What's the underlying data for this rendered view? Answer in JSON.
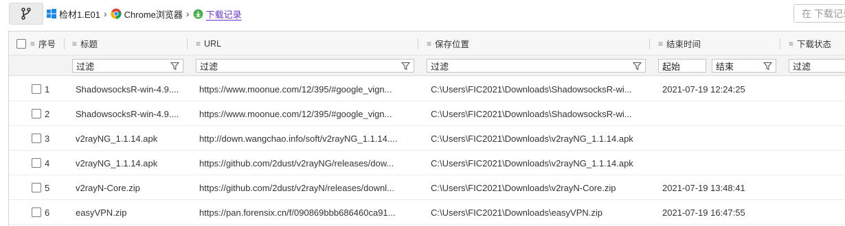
{
  "toolbar": {
    "branch_icon": "git-branch-icon"
  },
  "breadcrumb": [
    {
      "label": "检材1.E01",
      "icon": "windows-icon"
    },
    {
      "label": "Chrome浏览器",
      "icon": "chrome-icon"
    },
    {
      "label": "下载记录",
      "icon": "download-icon"
    }
  ],
  "breadcrumb_separator": "›",
  "search": {
    "placeholder": "在 下载记录中搜索"
  },
  "colors": {
    "breadcrumb_current": "#6a34c9",
    "download_icon": "#4caf50"
  },
  "table": {
    "columns": [
      {
        "key": "index",
        "label": "序号"
      },
      {
        "key": "title",
        "label": "标题"
      },
      {
        "key": "url",
        "label": "URL"
      },
      {
        "key": "save_path",
        "label": "保存位置"
      },
      {
        "key": "end_time",
        "label": "结束时间"
      },
      {
        "key": "status",
        "label": "下载状态"
      }
    ],
    "filters": {
      "title": "过滤",
      "url": "过滤",
      "save_path": "过滤",
      "end_time_start": "起始",
      "end_time_end": "结束",
      "status": "过滤"
    },
    "rows": [
      {
        "index": "1",
        "title": "ShadowsocksR-win-4.9....",
        "url": "https://www.moonue.com/12/395/#google_vign...",
        "save_path": "C:\\Users\\FIC2021\\Downloads\\ShadowsocksR-wi...",
        "end_time": "2021-07-19 12:24:25",
        "status": ""
      },
      {
        "index": "2",
        "title": "ShadowsocksR-win-4.9....",
        "url": "https://www.moonue.com/12/395/#google_vign...",
        "save_path": "C:\\Users\\FIC2021\\Downloads\\ShadowsocksR-wi...",
        "end_time": "",
        "status": ""
      },
      {
        "index": "3",
        "title": "v2rayNG_1.1.14.apk",
        "url": "http://down.wangchao.info/soft/v2rayNG_1.1.14....",
        "save_path": "C:\\Users\\FIC2021\\Downloads\\v2rayNG_1.1.14.apk",
        "end_time": "",
        "status": ""
      },
      {
        "index": "4",
        "title": "v2rayNG_1.1.14.apk",
        "url": "https://github.com/2dust/v2rayNG/releases/dow...",
        "save_path": "C:\\Users\\FIC2021\\Downloads\\v2rayNG_1.1.14.apk",
        "end_time": "",
        "status": ""
      },
      {
        "index": "5",
        "title": "v2rayN-Core.zip",
        "url": "https://github.com/2dust/v2rayN/releases/downl...",
        "save_path": "C:\\Users\\FIC2021\\Downloads\\v2rayN-Core.zip",
        "end_time": "2021-07-19 13:48:41",
        "status": ""
      },
      {
        "index": "6",
        "title": "easyVPN.zip",
        "url": "https://pan.forensix.cn/f/090869bbb686460ca91...",
        "save_path": "C:\\Users\\FIC2021\\Downloads\\easyVPN.zip",
        "end_time": "2021-07-19 16:47:55",
        "status": ""
      }
    ]
  }
}
